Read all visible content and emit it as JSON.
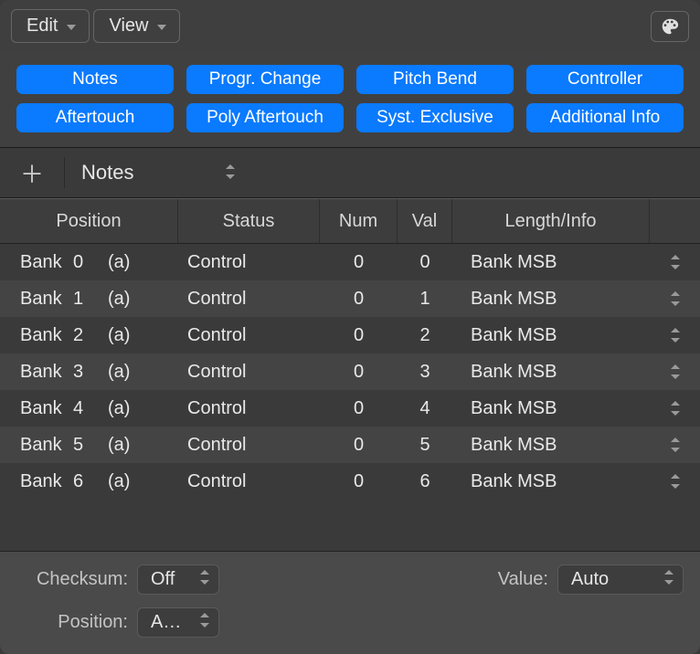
{
  "toolbar": {
    "edit": "Edit",
    "view": "View"
  },
  "filters": {
    "row1": [
      "Notes",
      "Progr. Change",
      "Pitch Bend",
      "Controller"
    ],
    "row2": [
      "Aftertouch",
      "Poly Aftertouch",
      "Syst. Exclusive",
      "Additional Info"
    ]
  },
  "addbar": {
    "type": "Notes"
  },
  "columns": {
    "position": "Position",
    "status": "Status",
    "num": "Num",
    "val": "Val",
    "length": "Length/Info"
  },
  "rows": [
    {
      "pos_a": "Bank",
      "pos_b": "0",
      "pos_c": "(a)",
      "status": "Control",
      "num": "0",
      "val": "0",
      "info": "Bank MSB"
    },
    {
      "pos_a": "Bank",
      "pos_b": "1",
      "pos_c": "(a)",
      "status": "Control",
      "num": "0",
      "val": "1",
      "info": "Bank MSB"
    },
    {
      "pos_a": "Bank",
      "pos_b": "2",
      "pos_c": "(a)",
      "status": "Control",
      "num": "0",
      "val": "2",
      "info": "Bank MSB"
    },
    {
      "pos_a": "Bank",
      "pos_b": "3",
      "pos_c": "(a)",
      "status": "Control",
      "num": "0",
      "val": "3",
      "info": "Bank MSB"
    },
    {
      "pos_a": "Bank",
      "pos_b": "4",
      "pos_c": "(a)",
      "status": "Control",
      "num": "0",
      "val": "4",
      "info": "Bank MSB"
    },
    {
      "pos_a": "Bank",
      "pos_b": "5",
      "pos_c": "(a)",
      "status": "Control",
      "num": "0",
      "val": "5",
      "info": "Bank MSB"
    },
    {
      "pos_a": "Bank",
      "pos_b": "6",
      "pos_c": "(a)",
      "status": "Control",
      "num": "0",
      "val": "6",
      "info": "Bank MSB"
    }
  ],
  "footer": {
    "checksum_label": "Checksum:",
    "checksum_value": "Off",
    "value_label": "Value:",
    "value_value": "Auto",
    "position_label": "Position:",
    "position_value": "A…"
  }
}
